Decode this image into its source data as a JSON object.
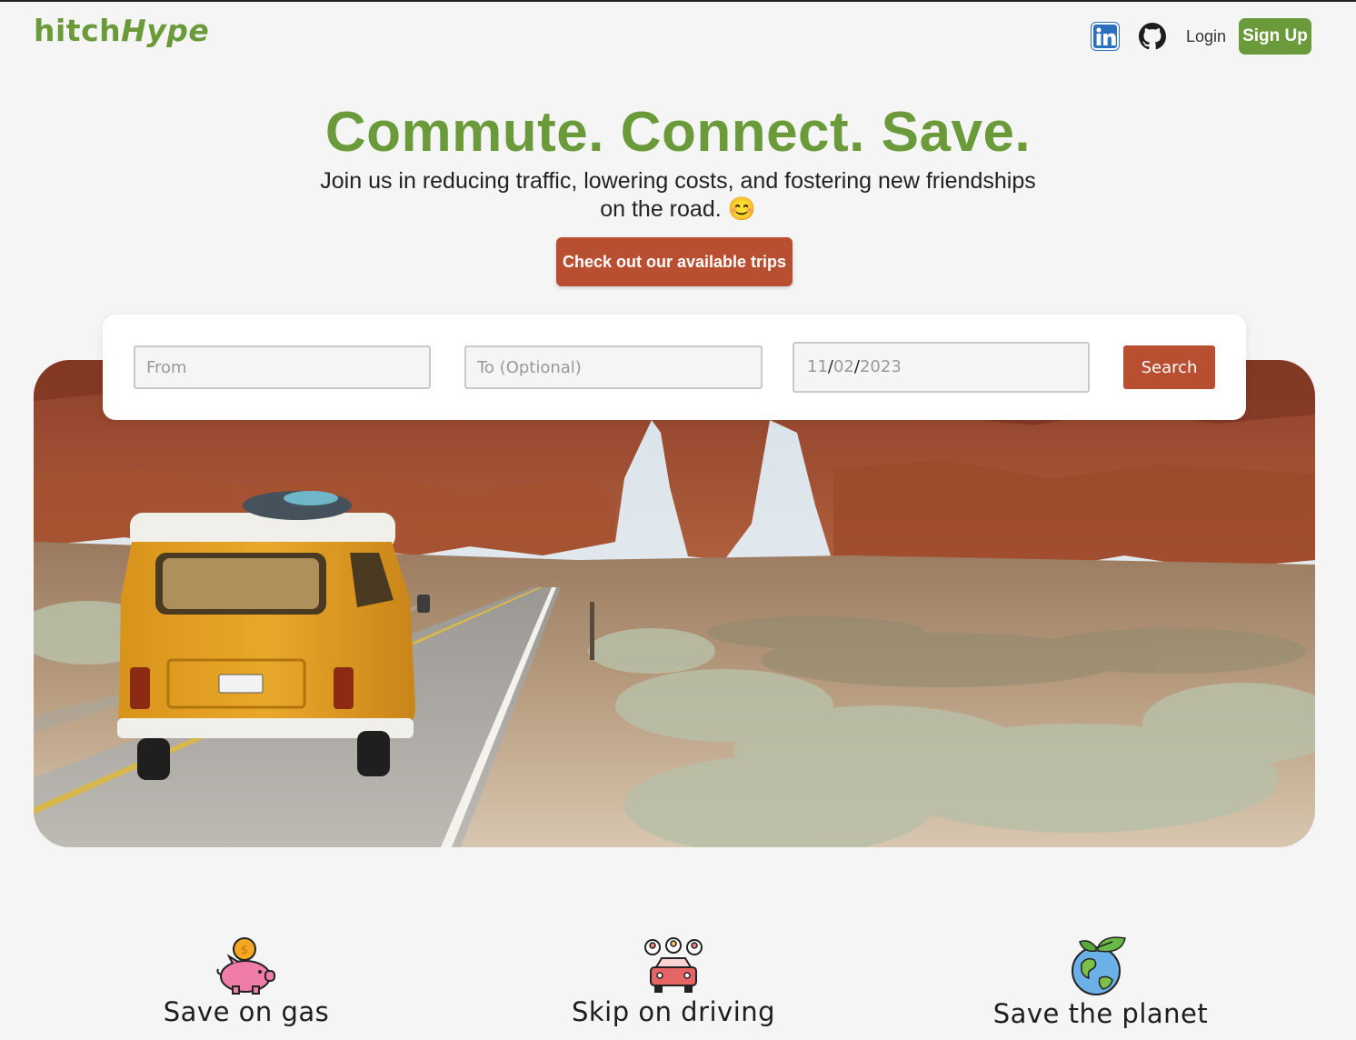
{
  "header": {
    "logo_part1": "hitch",
    "logo_part2": "Hype",
    "linkedin_icon": "linkedin-icon",
    "github_icon": "github-icon",
    "login_label": "Login",
    "signup_label": "Sign Up"
  },
  "hero": {
    "title": "Commute. Connect. Save.",
    "subtitle": "Join us in reducing traffic, lowering costs, and fostering new friendships on the road. 😊",
    "cta_label": "Check out our available trips"
  },
  "search": {
    "from_placeholder": "From",
    "to_placeholder": "To (Optional)",
    "date_month": "11",
    "date_day": "02",
    "date_year": "2023",
    "date_sep": "/",
    "search_label": "Search"
  },
  "features": [
    {
      "label": "Save on gas",
      "icon": "piggy-bank-icon"
    },
    {
      "label": "Skip on driving",
      "icon": "carpool-icon"
    },
    {
      "label": "Save the planet",
      "icon": "earth-icon"
    }
  ],
  "colors": {
    "brand_green": "#6a9a3a",
    "accent_red": "#b94f31",
    "background": "#f5f5f5"
  }
}
